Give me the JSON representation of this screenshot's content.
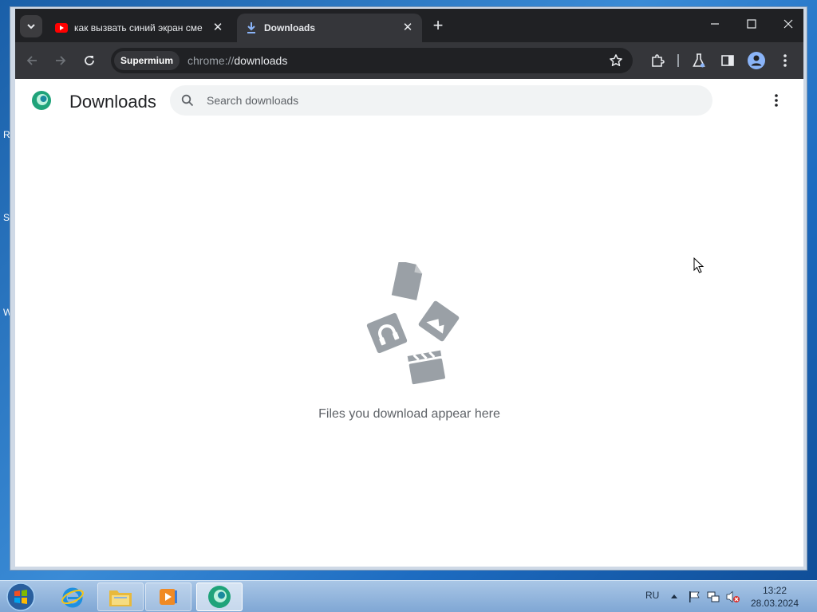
{
  "desktop": {
    "edge_letters": [
      "R",
      "S",
      "W"
    ]
  },
  "tabs": [
    {
      "title": "как вызвать синий экран сме",
      "favicon": "youtube-icon",
      "active": false
    },
    {
      "title": "Downloads",
      "favicon": "download-icon",
      "active": true
    }
  ],
  "toolbar": {
    "site_chip": "Supermium",
    "url_scheme": "chrome://",
    "url_host": "downloads"
  },
  "page": {
    "title": "Downloads",
    "search_placeholder": "Search downloads",
    "empty_message": "Files you download appear here"
  },
  "taskbar": {
    "language": "RU",
    "time": "13:22",
    "date": "28.03.2024",
    "apps": [
      "internet-explorer-icon",
      "file-explorer-icon",
      "media-player-icon",
      "supermium-icon"
    ]
  },
  "colors": {
    "titlebar": "#202124",
    "toolbar": "#35363a",
    "page_bg": "#ffffff",
    "search_bg": "#f1f3f4",
    "empty_art": "#9aa0a6",
    "brand_green": "#1fa37a"
  }
}
